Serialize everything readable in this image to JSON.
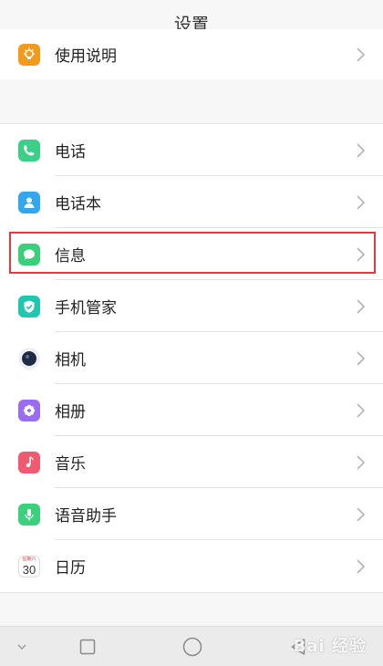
{
  "header": {
    "title": "设置"
  },
  "top_item": {
    "label": "使用说明",
    "icon": "lightbulb-icon",
    "color": "#f39a1b"
  },
  "items": [
    {
      "label": "电话",
      "icon": "phone-icon",
      "color": "#3bcf88"
    },
    {
      "label": "电话本",
      "icon": "contacts-icon",
      "color": "#33a7ee"
    },
    {
      "label": "信息",
      "icon": "message-icon",
      "color": "#3ccf7a"
    },
    {
      "label": "手机管家",
      "icon": "shield-icon",
      "color": "#20c7ae"
    },
    {
      "label": "相机",
      "icon": "camera-icon",
      "color": "#1f2a44"
    },
    {
      "label": "相册",
      "icon": "album-icon",
      "color": "#9a6cf0"
    },
    {
      "label": "音乐",
      "icon": "music-icon",
      "color": "#f05a70"
    },
    {
      "label": "语音助手",
      "icon": "microphone-icon",
      "color": "#3ad07e"
    },
    {
      "label": "日历",
      "icon": "calendar-icon",
      "color": "#ffffff",
      "day": "30",
      "weekday": "星期六"
    }
  ],
  "watermark": "Bai 经验",
  "accent": "#e0393e"
}
